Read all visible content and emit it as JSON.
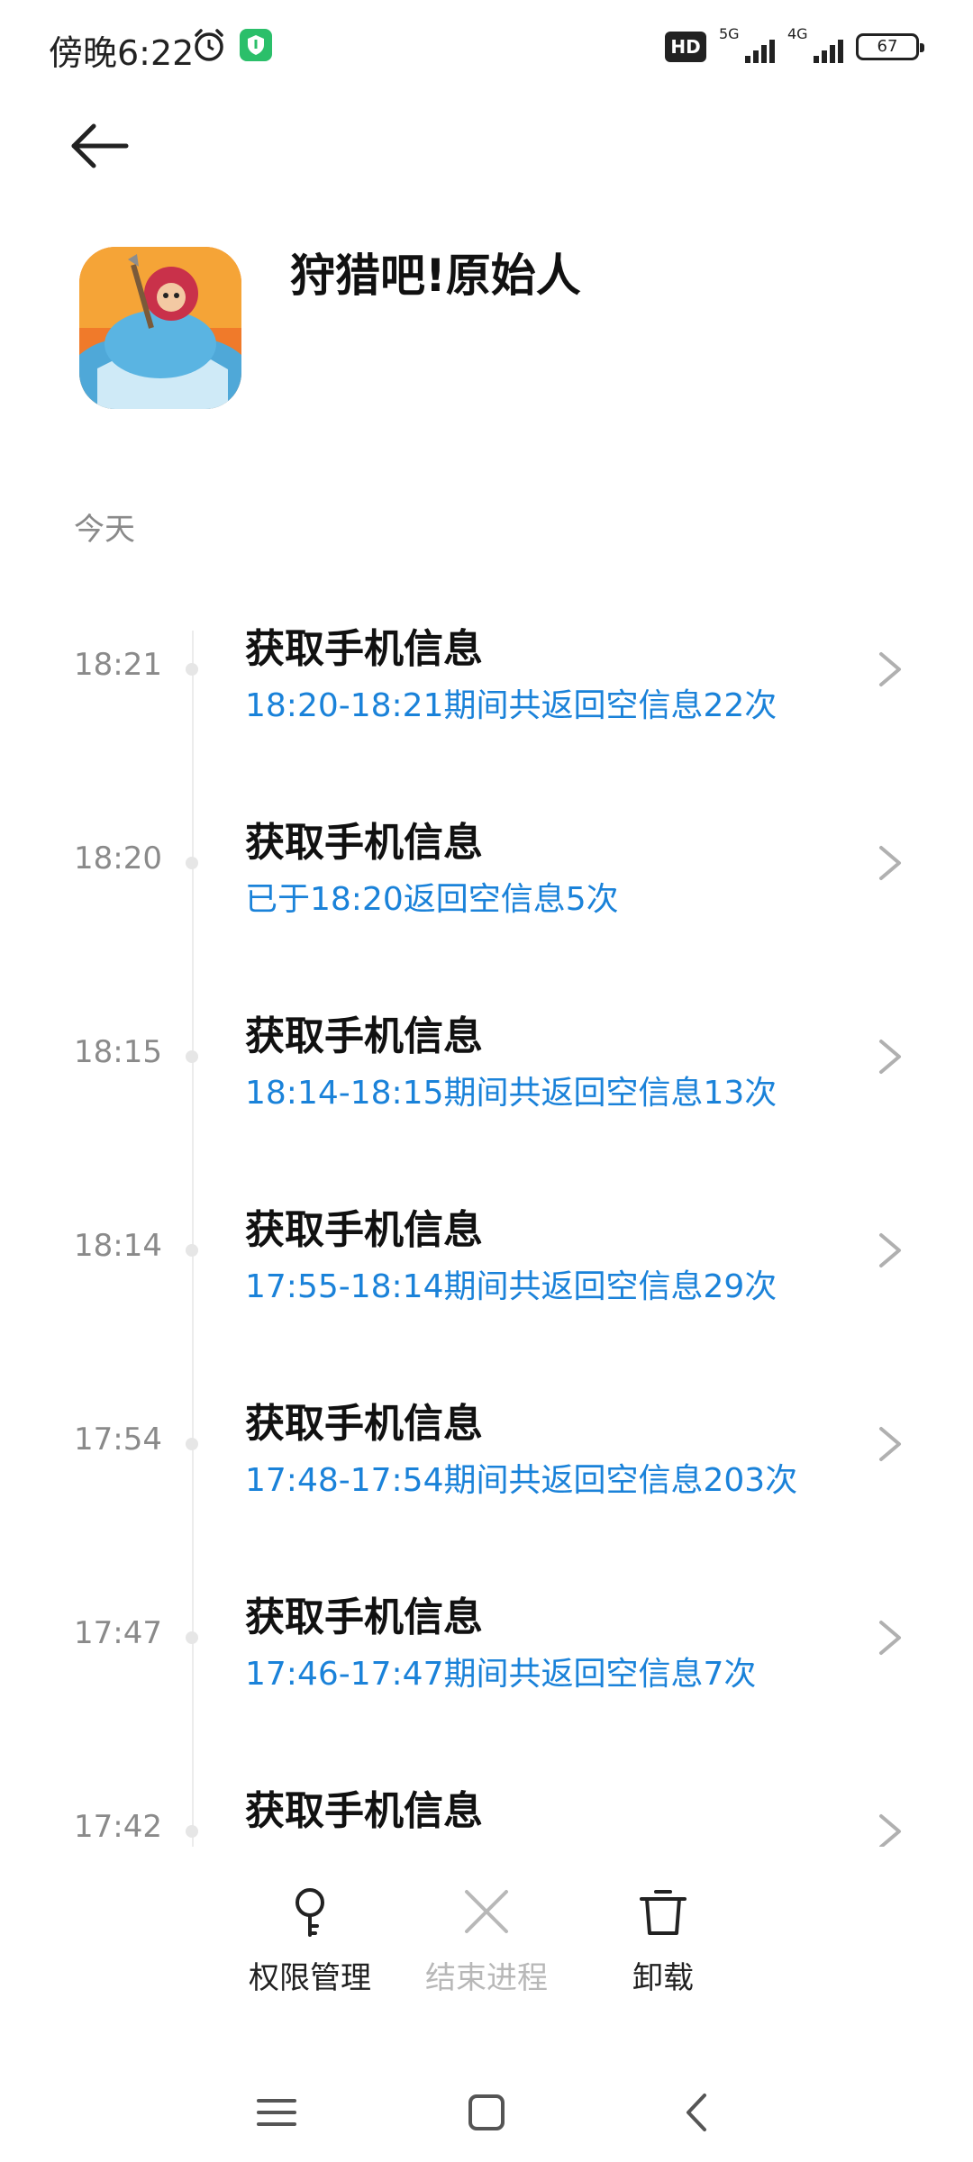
{
  "status_bar": {
    "time": "傍晚6:22",
    "hd_label": "HD",
    "net1_label": "5G",
    "net2_label": "4G",
    "battery": "67"
  },
  "app": {
    "name": "狩猎吧!原始人"
  },
  "section": {
    "label": "今天"
  },
  "entries": [
    {
      "time": "18:21",
      "title": "获取手机信息",
      "detail": "18:20-18:21期间共返回空信息22次"
    },
    {
      "time": "18:20",
      "title": "获取手机信息",
      "detail": "已于18:20返回空信息5次"
    },
    {
      "time": "18:15",
      "title": "获取手机信息",
      "detail": "18:14-18:15期间共返回空信息13次"
    },
    {
      "time": "18:14",
      "title": "获取手机信息",
      "detail": "17:55-18:14期间共返回空信息29次"
    },
    {
      "time": "17:54",
      "title": "获取手机信息",
      "detail": "17:48-17:54期间共返回空信息203次"
    },
    {
      "time": "17:47",
      "title": "获取手机信息",
      "detail": "17:46-17:47期间共返回空信息7次"
    },
    {
      "time": "17:42",
      "title": "获取手机信息",
      "detail": ""
    }
  ],
  "actions": {
    "permissions": "权限管理",
    "end_process": "结束进程",
    "uninstall": "卸载"
  },
  "colors": {
    "accent": "#1a82d9",
    "muted": "#8a8a8a",
    "disabled": "#b8b8b8"
  },
  "icons": {
    "back": "arrow-left-icon",
    "permissions": "key-icon",
    "end_process": "close-icon",
    "uninstall": "trash-icon",
    "nav_menu": "menu-icon",
    "nav_home": "home-icon",
    "nav_back": "chevron-left-icon"
  }
}
